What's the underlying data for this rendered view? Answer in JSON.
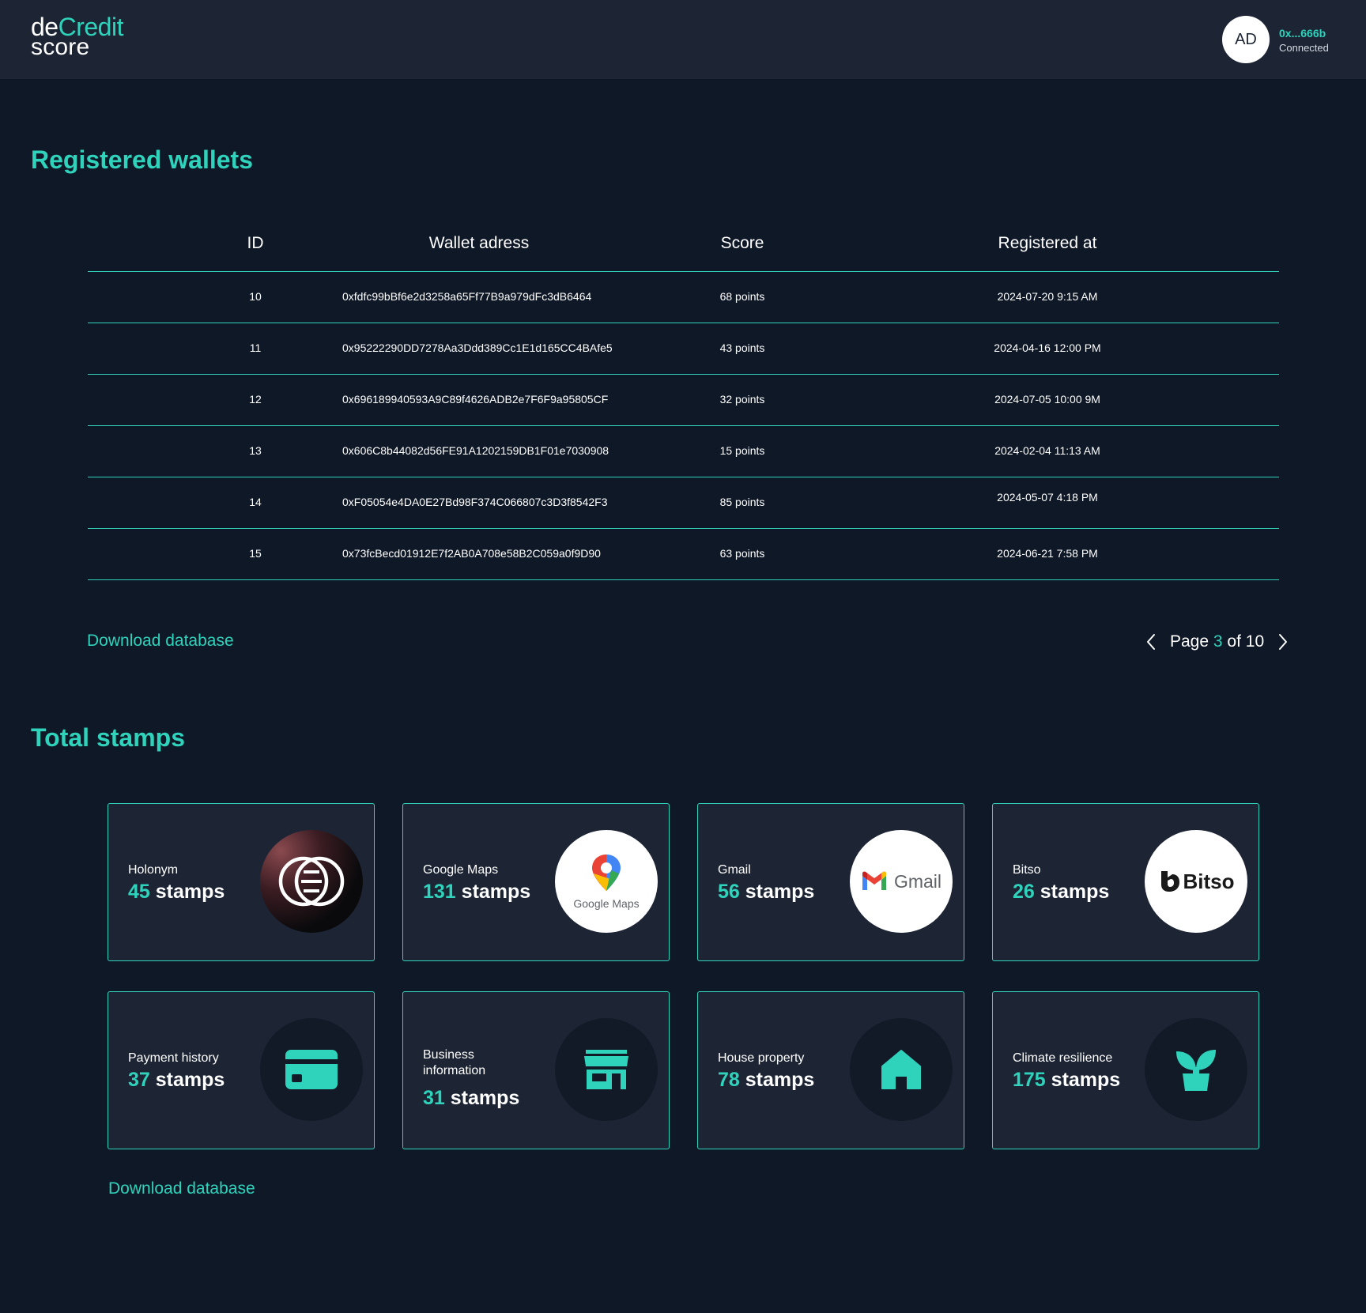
{
  "header": {
    "logo_de": "de",
    "logo_credit": "Credit",
    "logo_score": "score",
    "avatar_initials": "AD",
    "account_address": "0x...666b",
    "account_status": "Connected"
  },
  "wallets": {
    "title": "Registered wallets",
    "columns": [
      "ID",
      "Wallet adress",
      "Score",
      "Registered at"
    ],
    "rows": [
      {
        "id": "10",
        "address": "0xfdfc99bBf6e2d3258a65Ff77B9a979dFc3dB6464",
        "score": "68 points",
        "registered": "2024-07-20 9:15 AM"
      },
      {
        "id": "11",
        "address": "0x95222290DD7278Aa3Ddd389Cc1E1d165CC4BAfe5",
        "score": "43 points",
        "registered": "2024-04-16 12:00 PM"
      },
      {
        "id": "12",
        "address": "0x696189940593A9C89f4626ADB2e7F6F9a95805CF",
        "score": "32 points",
        "registered": "2024-07-05 10:00 9M"
      },
      {
        "id": "13",
        "address": "0x606C8b44082d56FE91A1202159DB1F01e7030908",
        "score": "15 points",
        "registered": "2024-02-04 11:13 AM"
      },
      {
        "id": "14",
        "address": "0xF05054e4DA0E27Bd98F374C066807c3D3f8542F3",
        "score": "85 points",
        "registered": "2024-05-07 4:18 PM"
      },
      {
        "id": "15",
        "address": "0x73fcBecd01912E7f2AB0A708e58B2C059a0f9D90",
        "score": "63 points",
        "registered": "2024-06-21 7:58 PM"
      }
    ],
    "download_label": "Download database",
    "pagination": {
      "prefix": "Page",
      "current": "3",
      "middle": "of",
      "total": "10"
    }
  },
  "stamps": {
    "title": "Total stamps",
    "unit": "stamps",
    "cards": [
      {
        "label": "Holonym",
        "count": "45",
        "icon": "holonym-logo-icon"
      },
      {
        "label": "Google Maps",
        "count": "131",
        "icon": "google-maps-logo-icon",
        "logo_text": "Google Maps"
      },
      {
        "label": "Gmail",
        "count": "56",
        "icon": "gmail-logo-icon",
        "logo_text": "Gmail"
      },
      {
        "label": "Bitso",
        "count": "26",
        "icon": "bitso-logo-icon",
        "logo_text": "Bitso"
      },
      {
        "label": "Payment history",
        "count": "37",
        "icon": "credit-card-icon"
      },
      {
        "label": "Business information",
        "count": "31",
        "icon": "storefront-icon"
      },
      {
        "label": "House property",
        "count": "78",
        "icon": "house-icon"
      },
      {
        "label": "Climate resilience",
        "count": "175",
        "icon": "sprout-icon"
      }
    ],
    "download_label": "Download database"
  },
  "colors": {
    "accent": "#2fd3bb",
    "background": "#0f1827",
    "panel": "#1d2535"
  }
}
